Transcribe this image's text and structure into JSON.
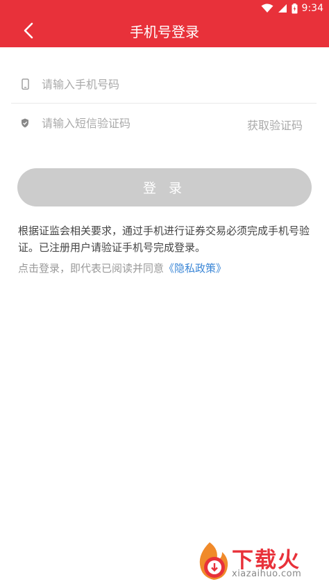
{
  "status_bar": {
    "time": "9:34"
  },
  "header": {
    "title": "手机号登录"
  },
  "form": {
    "phone": {
      "placeholder": "请输入手机号码",
      "value": ""
    },
    "code": {
      "placeholder": "请输入短信验证码",
      "value": ""
    },
    "get_code_label": "获取验证码",
    "login_label": "登 录"
  },
  "notice": "根据证监会相关要求，通过手机进行证券交易必须完成手机号验证。已注册用户请验证手机号完成登录。",
  "agreement": {
    "prefix": "点击登录，即代表已阅读并同意",
    "link_label": "《隐私政策》"
  },
  "watermark": {
    "brand": "下载火",
    "domain": "xiazaihuo.com"
  },
  "colors": {
    "primary": "#e8313a",
    "button_disabled": "#cccccc",
    "link": "#3a86d6"
  },
  "icons": {
    "back": "chevron-left-icon",
    "phone": "phone-icon",
    "shield": "shield-icon",
    "wifi": "wifi-icon",
    "signal": "signal-icon",
    "battery": "battery-icon"
  }
}
